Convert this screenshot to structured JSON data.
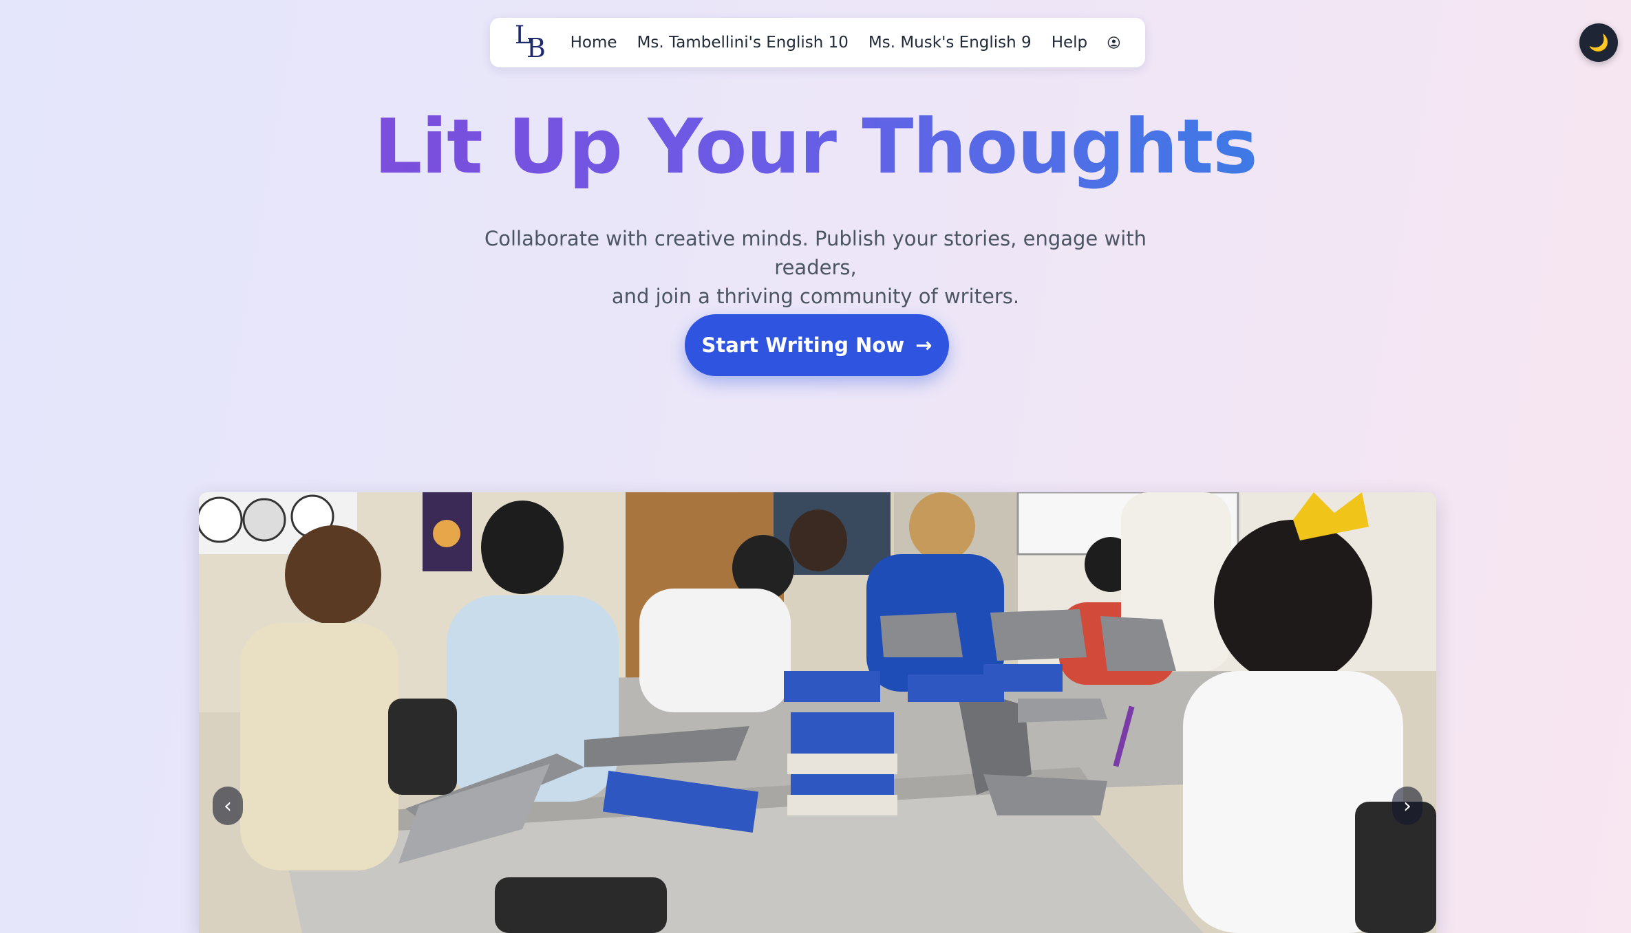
{
  "nav": {
    "logo_letter_1": "L",
    "logo_letter_2": "B",
    "links": [
      {
        "label": "Home"
      },
      {
        "label": "Ms. Tambellini's English 10"
      },
      {
        "label": "Ms. Musk's English 9"
      },
      {
        "label": "Help"
      }
    ],
    "profile_icon": "user-circle-icon"
  },
  "theme_toggle": {
    "icon": "moon-icon",
    "glyph": "🌙"
  },
  "hero": {
    "title": "Lit Up Your Thoughts",
    "subtitle_line1": "Collaborate with creative minds. Publish your stories, engage with readers,",
    "subtitle_line2": "and join a thriving community of writers.",
    "cta_label": "Start Writing Now",
    "cta_arrow": "→"
  },
  "carousel": {
    "image_subject": "classroom-photo",
    "prev_glyph": "‹",
    "next_glyph": "›"
  },
  "colors": {
    "accent_blue": "#2f55e0",
    "title_gradient_start": "#7c4ddc",
    "title_gradient_end": "#3e7ae6",
    "logo": "#1e2a6e"
  }
}
